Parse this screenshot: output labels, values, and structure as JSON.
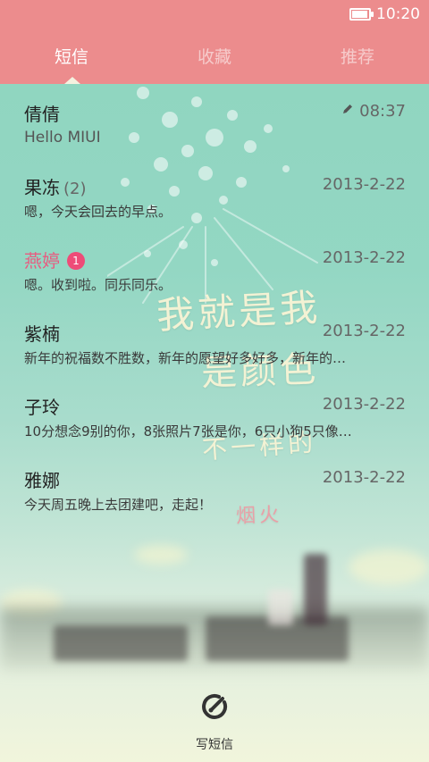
{
  "status": {
    "time": "10:20",
    "battery_level": 0.85
  },
  "tabs": [
    {
      "label": "短信",
      "active": true
    },
    {
      "label": "收藏",
      "active": false
    },
    {
      "label": "推荐",
      "active": false
    }
  ],
  "conversations": [
    {
      "name": "倩倩",
      "count": "",
      "badge": "",
      "date": "08:37",
      "preview": "Hello MIUI",
      "draft": true
    },
    {
      "name": "果冻",
      "count": "(2)",
      "badge": "",
      "date": "2013-2-22",
      "preview": "嗯，今天会回去的早点。",
      "draft": false
    },
    {
      "name": "燕婷",
      "count": "",
      "badge": "1",
      "date": "2013-2-22",
      "preview": "嗯。收到啦。同乐同乐。",
      "draft": false
    },
    {
      "name": "紫楠",
      "count": "",
      "badge": "",
      "date": "2013-2-22",
      "preview": "新年的祝福数不胜数，新年的愿望好多好多，新年的…",
      "draft": false
    },
    {
      "name": "子玲",
      "count": "",
      "badge": "",
      "date": "2013-2-22",
      "preview": "10分想念9别的你，8张照片7张是你，6只小狗5只像…",
      "draft": false
    },
    {
      "name": "雅娜",
      "count": "",
      "badge": "",
      "date": "2013-2-22",
      "preview": "今天周五晚上去团建吧，走起！",
      "draft": false
    }
  ],
  "wallpaper_text": [
    "我就是我",
    "是颜色",
    "不一样的",
    "烟火"
  ],
  "compose": {
    "label": "写短信",
    "icon": "compose-icon"
  },
  "colors": {
    "header": "#ec8c8d",
    "unread_name": "#e85b80",
    "badge": "#ee4c78"
  }
}
